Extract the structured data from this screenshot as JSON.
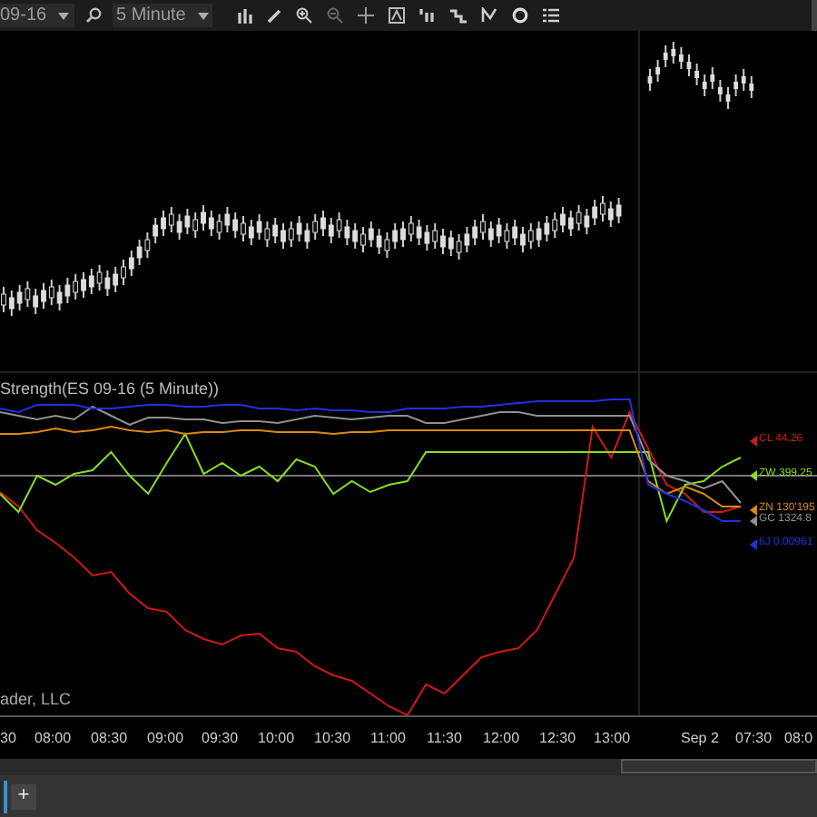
{
  "toolbar": {
    "instrument": "09-16",
    "interval": "5 Minute"
  },
  "indicator_panel": {
    "title": "Strength(ES 09-16 (5 Minute))",
    "series": [
      {
        "label": "CL 44.26",
        "color": "#d01818"
      },
      {
        "label": "ZW 399.25",
        "color": "#88dd22"
      },
      {
        "label": "ZN 130'195",
        "color": "#d88a10"
      },
      {
        "label": "GC 1324.8",
        "color": "#909090"
      },
      {
        "label": "6J 0.00961",
        "color": "#2030e0"
      }
    ]
  },
  "copyright": "ader, LLC",
  "time_axis": [
    "30",
    "08:00",
    "08:30",
    "09:00",
    "09:30",
    "10:00",
    "10:30",
    "11:00",
    "11:30",
    "12:00",
    "12:30",
    "13:00",
    "Sep 2",
    "07:30",
    "08:0"
  ],
  "add_tab": "+"
}
